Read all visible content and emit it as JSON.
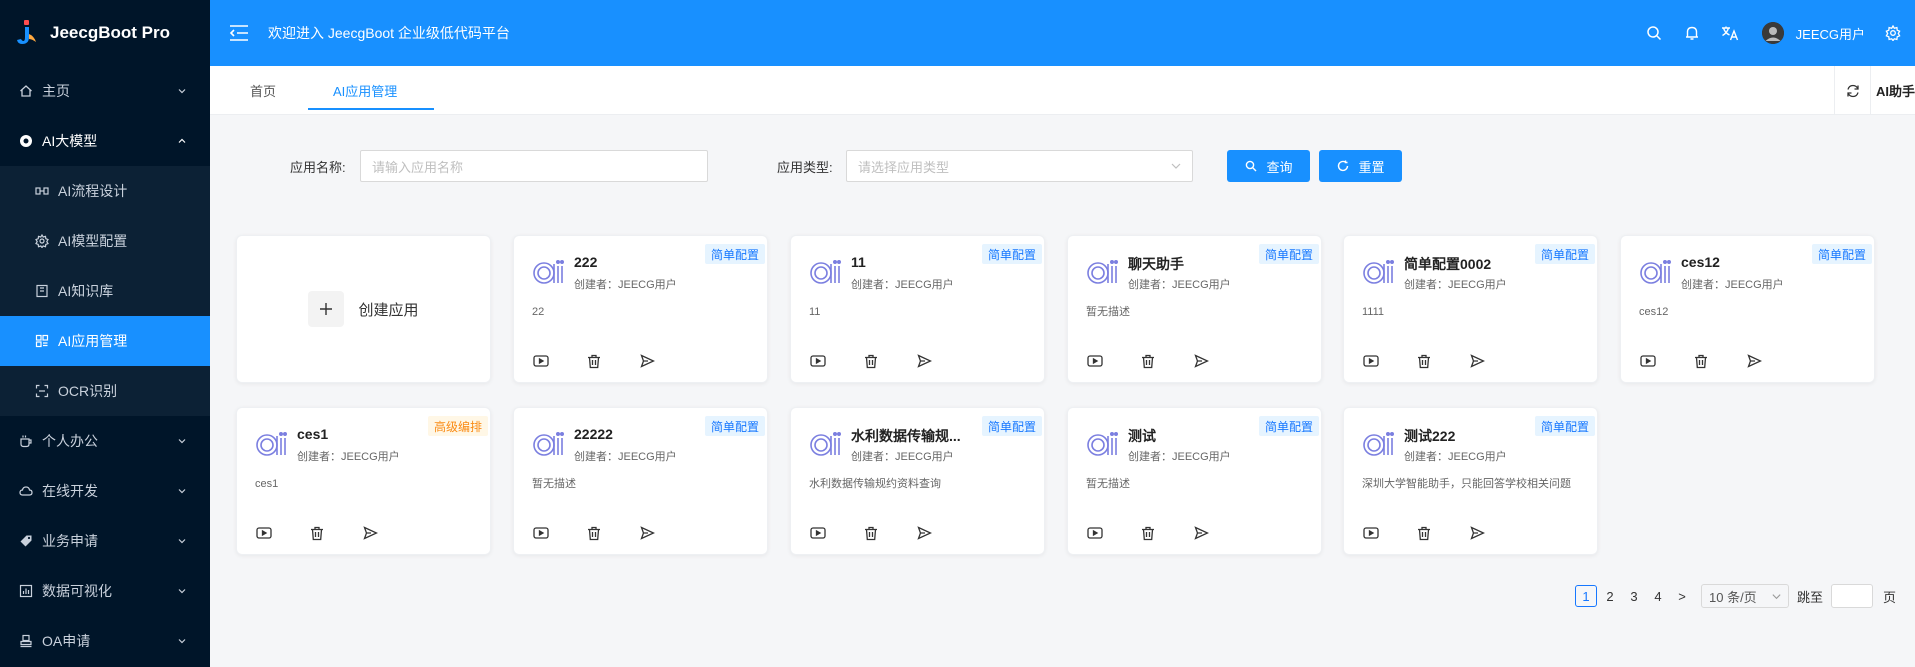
{
  "brand": {
    "name": "JeecgBoot Pro"
  },
  "sidebar": {
    "items": [
      {
        "label": "主页",
        "icon": "home-icon",
        "expanded": false
      },
      {
        "label": "AI大模型",
        "icon": "ai-model-icon",
        "expanded": true,
        "children": [
          {
            "label": "AI流程设计",
            "icon": "flow-icon"
          },
          {
            "label": "AI模型配置",
            "icon": "gear-icon"
          },
          {
            "label": "AI知识库",
            "icon": "book-icon"
          },
          {
            "label": "AI应用管理",
            "icon": "app-grid-icon",
            "active": true
          },
          {
            "label": "OCR识别",
            "icon": "scan-icon"
          }
        ]
      },
      {
        "label": "个人办公",
        "icon": "coffee-cup-icon",
        "expanded": false
      },
      {
        "label": "在线开发",
        "icon": "cloud-icon",
        "expanded": false
      },
      {
        "label": "业务申请",
        "icon": "tag-icon",
        "expanded": false
      },
      {
        "label": "数据可视化",
        "icon": "chart-board-icon",
        "expanded": false
      },
      {
        "label": "OA申请",
        "icon": "stamp-icon",
        "expanded": false
      }
    ]
  },
  "header": {
    "title": "欢迎进入 JeecgBoot 企业级低代码平台",
    "username": "JEECG用户",
    "icons": [
      "search-icon",
      "bell-icon",
      "translate-icon",
      "avatar",
      "gear-icon"
    ]
  },
  "tabs": {
    "items": [
      {
        "label": "首页",
        "active": false
      },
      {
        "label": "AI应用管理",
        "active": true
      }
    ],
    "ai_assistant": "AI助手"
  },
  "search": {
    "name_label": "应用名称:",
    "name_placeholder": "请输入应用名称",
    "type_label": "应用类型:",
    "type_placeholder": "请选择应用类型",
    "query_button": "查询",
    "reset_button": "重置"
  },
  "create_card": {
    "label": "创建应用"
  },
  "cards": [
    {
      "name": "222",
      "creator": "创建者：JEECG用户",
      "desc": "22",
      "badge": "简单配置",
      "badge_type": "simple"
    },
    {
      "name": "11",
      "creator": "创建者：JEECG用户",
      "desc": "11",
      "badge": "简单配置",
      "badge_type": "simple"
    },
    {
      "name": "聊天助手",
      "creator": "创建者：JEECG用户",
      "desc": "暂无描述",
      "badge": "简单配置",
      "badge_type": "simple"
    },
    {
      "name": "简单配置0002",
      "creator": "创建者：JEECG用户",
      "desc": "1111",
      "badge": "简单配置",
      "badge_type": "simple"
    },
    {
      "name": "ces12",
      "creator": "创建者：JEECG用户",
      "desc": "ces12",
      "badge": "简单配置",
      "badge_type": "simple"
    },
    {
      "name": "ces1",
      "creator": "创建者：JEECG用户",
      "desc": "ces1",
      "badge": "高级编排",
      "badge_type": "advanced"
    },
    {
      "name": "22222",
      "creator": "创建者：JEECG用户",
      "desc": "暂无描述",
      "badge": "简单配置",
      "badge_type": "simple"
    },
    {
      "name": "水利数据传输规...",
      "creator": "创建者：JEECG用户",
      "desc": "水利数据传输规约资料查询",
      "badge": "简单配置",
      "badge_type": "simple"
    },
    {
      "name": "测试",
      "creator": "创建者：JEECG用户",
      "desc": "暂无描述",
      "badge": "简单配置",
      "badge_type": "simple"
    },
    {
      "name": "测试222",
      "creator": "创建者：JEECG用户",
      "desc": "深圳大学智能助手，只能回答学校相关问题",
      "badge": "简单配置",
      "badge_type": "simple"
    }
  ],
  "pagination": {
    "pages": [
      "1",
      "2",
      "3",
      "4"
    ],
    "current": "1",
    "next": ">",
    "page_size": "10 条/页",
    "jump_label": "跳至",
    "page_suffix": "页"
  },
  "colors": {
    "primary": "#1890ff",
    "sidebar_bg": "#001529",
    "badge_simple": "#1677ff",
    "badge_advanced": "#fa8c16"
  }
}
